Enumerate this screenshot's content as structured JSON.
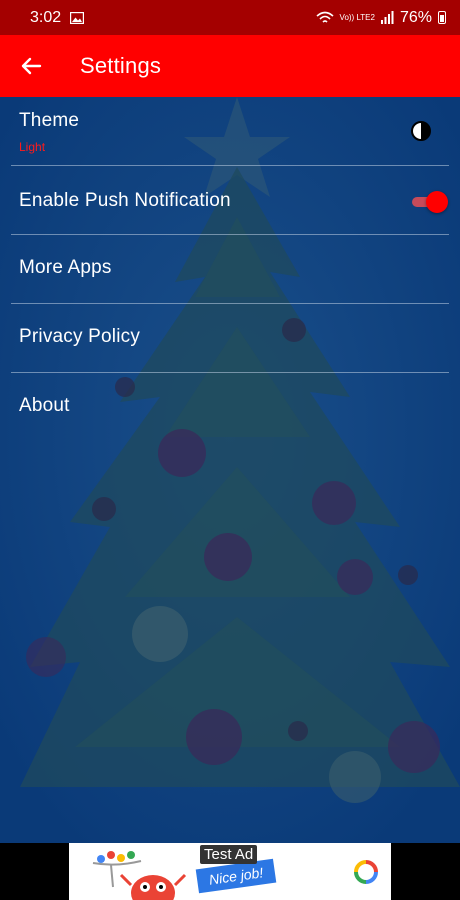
{
  "status_bar": {
    "time": "3:02",
    "network": "Vo)) LTE2",
    "battery": "76%"
  },
  "app_bar": {
    "title": "Settings"
  },
  "settings": {
    "theme": {
      "label": "Theme",
      "value": "Light"
    },
    "push": {
      "label": "Enable Push Notification",
      "enabled": true
    },
    "more_apps": {
      "label": "More Apps"
    },
    "privacy": {
      "label": "Privacy Policy"
    },
    "about": {
      "label": "About"
    }
  },
  "ad": {
    "label": "Test Ad",
    "headline": "Nice job!"
  },
  "colors": {
    "status_bar": "#a40000",
    "app_bar": "#ff0000",
    "accent": "#ff0000",
    "background": "#0b3f7e"
  },
  "icons": [
    "back-arrow-icon",
    "theme-contrast-icon",
    "image-notification-icon",
    "wifi-icon",
    "signal-icon",
    "battery-icon"
  ]
}
